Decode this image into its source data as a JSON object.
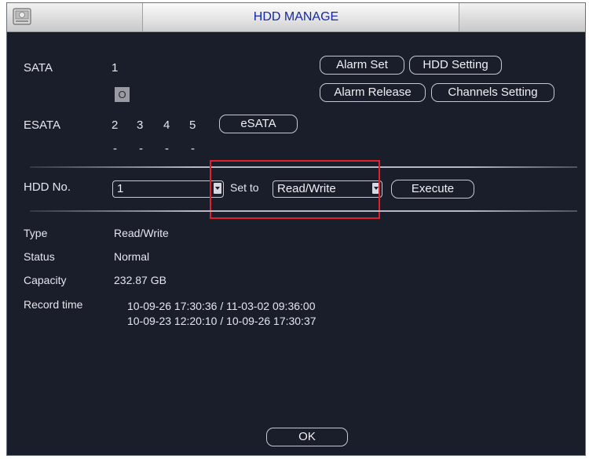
{
  "window": {
    "title": "HDD MANAGE",
    "icon": "hdd-icon"
  },
  "sata": {
    "label": "SATA",
    "slots": [
      "1"
    ],
    "indicators": [
      "O"
    ]
  },
  "esata": {
    "label": "ESATA",
    "slots": [
      "2",
      "3",
      "4",
      "5"
    ],
    "indicators": [
      "-",
      "-",
      "-",
      "-"
    ],
    "button_label": "eSATA"
  },
  "buttons": {
    "alarm_set": "Alarm Set",
    "hdd_setting": "HDD Setting",
    "alarm_release": "Alarm Release",
    "channels_setting": "Channels Setting",
    "execute": "Execute",
    "ok": "OK"
  },
  "hdd_select": {
    "label": "HDD No.",
    "value": "1"
  },
  "set_to": {
    "label": "Set to",
    "value": "Read/Write"
  },
  "info": {
    "type_label": "Type",
    "type_value": "Read/Write",
    "status_label": "Status",
    "status_value": "Normal",
    "capacity_label": "Capacity",
    "capacity_value": "232.87 GB",
    "record_time_label": "Record time",
    "record_time_lines": [
      "10-09-26 17:30:36 / 11-03-02 09:36:00",
      "10-09-23 12:20:10 / 10-09-26 17:30:37"
    ]
  },
  "colors": {
    "background": "#1a1d2a",
    "title_text": "#1428a8",
    "highlight": "#e0202a"
  }
}
